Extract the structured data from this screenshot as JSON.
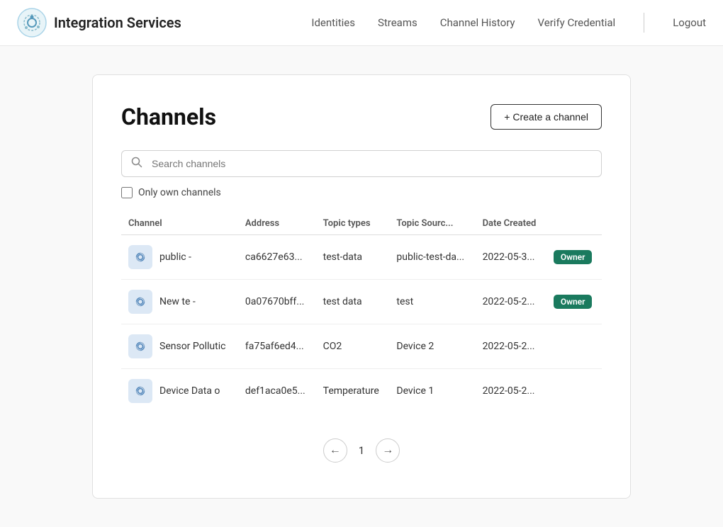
{
  "header": {
    "logo_title": "Integration Services",
    "nav": [
      {
        "label": "Identities",
        "id": "nav-identities"
      },
      {
        "label": "Streams",
        "id": "nav-streams"
      },
      {
        "label": "Channel History",
        "id": "nav-channel-history"
      },
      {
        "label": "Verify Credential",
        "id": "nav-verify-credential"
      }
    ],
    "logout_label": "Logout"
  },
  "page": {
    "title": "Channels",
    "create_btn_label": "+ Create a channel",
    "search_placeholder": "Search channels",
    "only_own_label": "Only own channels"
  },
  "table": {
    "headers": [
      "Channel",
      "Address",
      "Topic types",
      "Topic Sourc...",
      "Date Created",
      ""
    ],
    "rows": [
      {
        "name": "public -",
        "address": "ca6627e63...",
        "topic_types": "test-data",
        "topic_source": "public-test-da...",
        "date_created": "2022-05-3...",
        "badge": "Owner"
      },
      {
        "name": "New te -",
        "address": "0a07670bff...",
        "topic_types": "test data",
        "topic_source": "test",
        "date_created": "2022-05-2...",
        "badge": "Owner"
      },
      {
        "name": "Sensor Pollutic",
        "address": "fa75af6ed4...",
        "topic_types": "CO2",
        "topic_source": "Device 2",
        "date_created": "2022-05-2...",
        "badge": ""
      },
      {
        "name": "Device Data o",
        "address": "def1aca0e5...",
        "topic_types": "Temperature",
        "topic_source": "Device 1",
        "date_created": "2022-05-2...",
        "badge": ""
      }
    ]
  },
  "pagination": {
    "current_page": "1",
    "prev_icon": "←",
    "next_icon": "→"
  }
}
